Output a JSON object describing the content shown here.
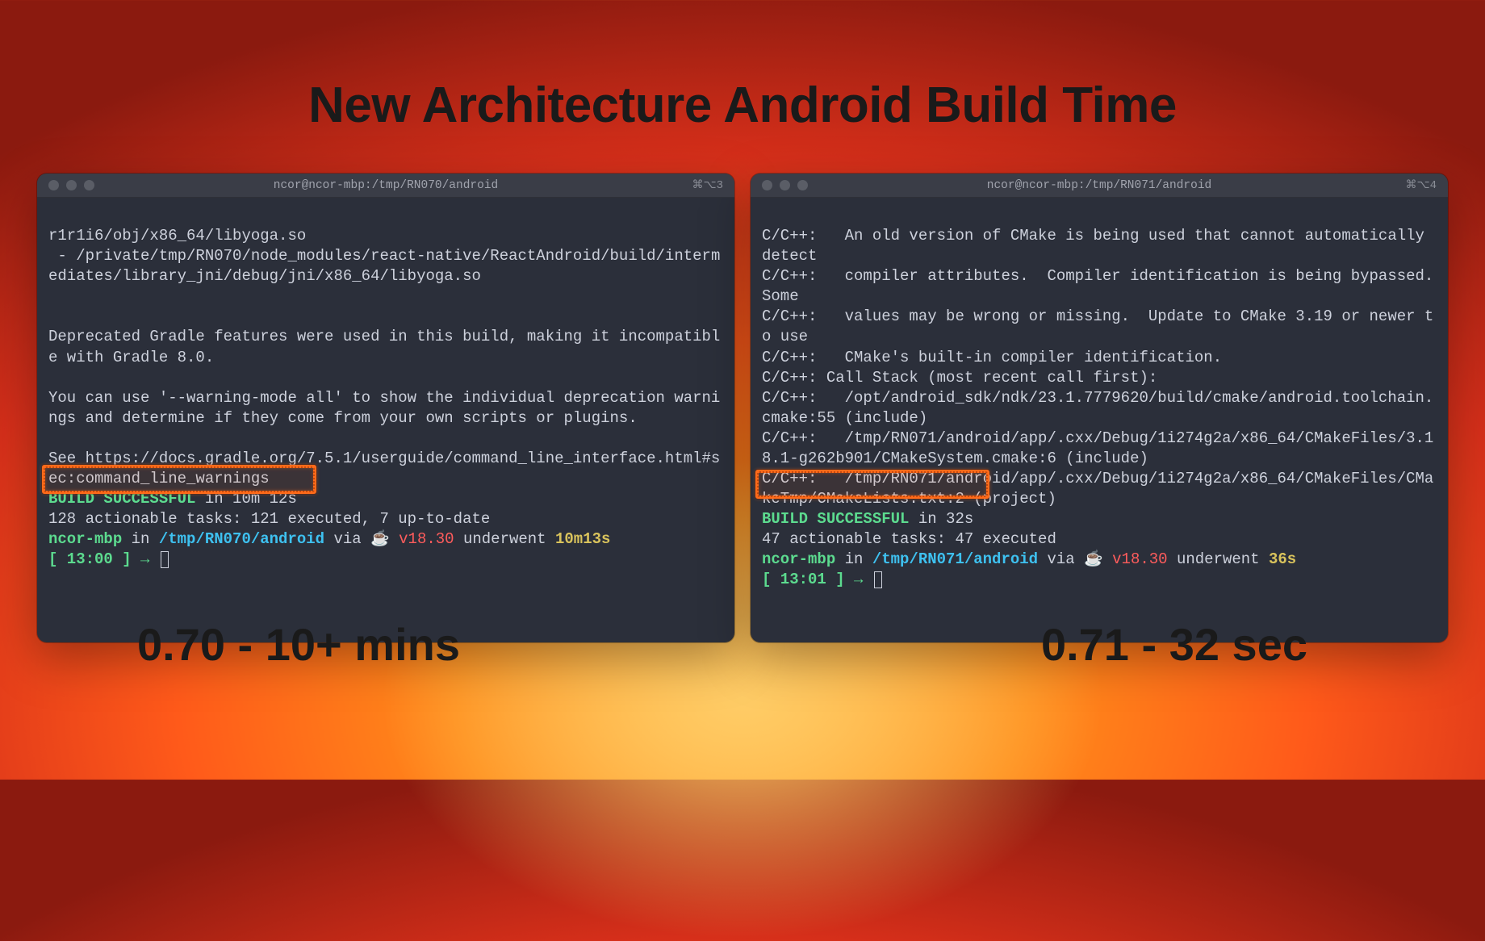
{
  "title": "New Architecture Android Build Time",
  "terminals": [
    {
      "titlebar": "ncor@ncor-mbp:/tmp/RN070/android",
      "session": "⌘⌥3",
      "lines": [
        "r1r1i6/obj/x86_64/libyoga.so",
        " - /private/tmp/RN070/node_modules/react-native/ReactAndroid/build/intermediates/library_jni/debug/jni/x86_64/libyoga.so",
        "",
        "",
        "Deprecated Gradle features were used in this build, making it incompatible with Gradle 8.0.",
        "",
        "You can use '--warning-mode all' to show the individual deprecation warnings and determine if they come from your own scripts or plugins.",
        "",
        "See https://docs.gradle.org/7.5.1/userguide/command_line_interface.html#sec:command_line_warnings"
      ],
      "build_line": {
        "success": "BUILD SUCCESSFUL",
        "suffix": " in 10m 12s"
      },
      "tasks": "128 actionable tasks: 121 executed, 7 up-to-date",
      "prompt": {
        "host": "ncor-mbp",
        "path": "/tmp/RN070/android",
        "via": " via ☕ ",
        "version": "v18.30",
        "underwent": " underwent ",
        "elapsed": "10m13s",
        "time": "[ 13:00 ]",
        "arrow": " → "
      }
    },
    {
      "titlebar": "ncor@ncor-mbp:/tmp/RN071/android",
      "session": "⌘⌥4",
      "lines": [
        "C/C++:   An old version of CMake is being used that cannot automatically detect",
        "C/C++:   compiler attributes.  Compiler identification is being bypassed.  Some",
        "C/C++:   values may be wrong or missing.  Update to CMake 3.19 or newer to use",
        "C/C++:   CMake's built-in compiler identification.",
        "C/C++: Call Stack (most recent call first):",
        "C/C++:   /opt/android_sdk/ndk/23.1.7779620/build/cmake/android.toolchain.cmake:55 (include)",
        "C/C++:   /tmp/RN071/android/app/.cxx/Debug/1i274g2a/x86_64/CMakeFiles/3.18.1-g262b901/CMakeSystem.cmake:6 (include)",
        "C/C++:   /tmp/RN071/android/app/.cxx/Debug/1i274g2a/x86_64/CMakeFiles/CMakeTmp/CMakeLists.txt:2 (project)"
      ],
      "build_line": {
        "success": "BUILD SUCCESSFUL",
        "suffix": " in 32s"
      },
      "tasks": "47 actionable tasks: 47 executed",
      "prompt": {
        "host": "ncor-mbp",
        "path": "/tmp/RN071/android",
        "via": " via ☕ ",
        "version": "v18.30",
        "underwent": " underwent ",
        "elapsed": "36s",
        "time": "[ 13:01 ]",
        "arrow": " → "
      }
    }
  ],
  "captions": {
    "left": "0.70 - 10+ mins",
    "right": "0.71 - 32 sec"
  }
}
